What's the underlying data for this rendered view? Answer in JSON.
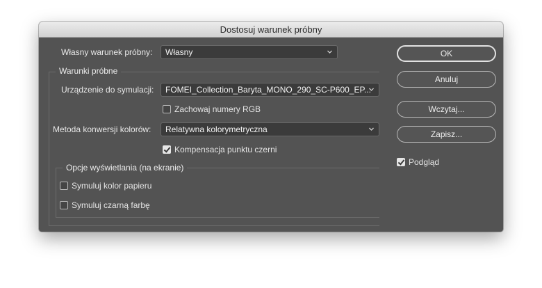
{
  "dialog": {
    "title": "Dostosuj warunek próbny"
  },
  "custom_condition": {
    "label": "Własny warunek próbny:",
    "value": "Własny"
  },
  "proof_conditions": {
    "legend": "Warunki próbne",
    "device_label": "Urządzenie do symulacji:",
    "device_value": "FOMEI_Collection_Baryta_MONO_290_SC-P600_EP...",
    "preserve_rgb": {
      "label": "Zachowaj numery RGB",
      "checked": false
    },
    "rendering_label": "Metoda konwersji kolorów:",
    "rendering_value": "Relatywna kolorymetryczna",
    "bpc": {
      "label": "Kompensacja punktu czerni",
      "checked": true
    }
  },
  "display_options": {
    "legend": "Opcje wyświetlania (na ekranie)",
    "paper_color": {
      "label": "Symuluj kolor papieru",
      "checked": false
    },
    "black_ink": {
      "label": "Symuluj czarną farbę",
      "checked": false
    }
  },
  "buttons": {
    "ok": "OK",
    "cancel": "Anuluj",
    "load": "Wczytaj...",
    "save": "Zapisz..."
  },
  "preview": {
    "label": "Podgląd",
    "checked": true
  },
  "colors": {
    "dialog_bg": "#535353",
    "field_bg": "#3b3b3b",
    "titlebar": "#dddddd"
  }
}
